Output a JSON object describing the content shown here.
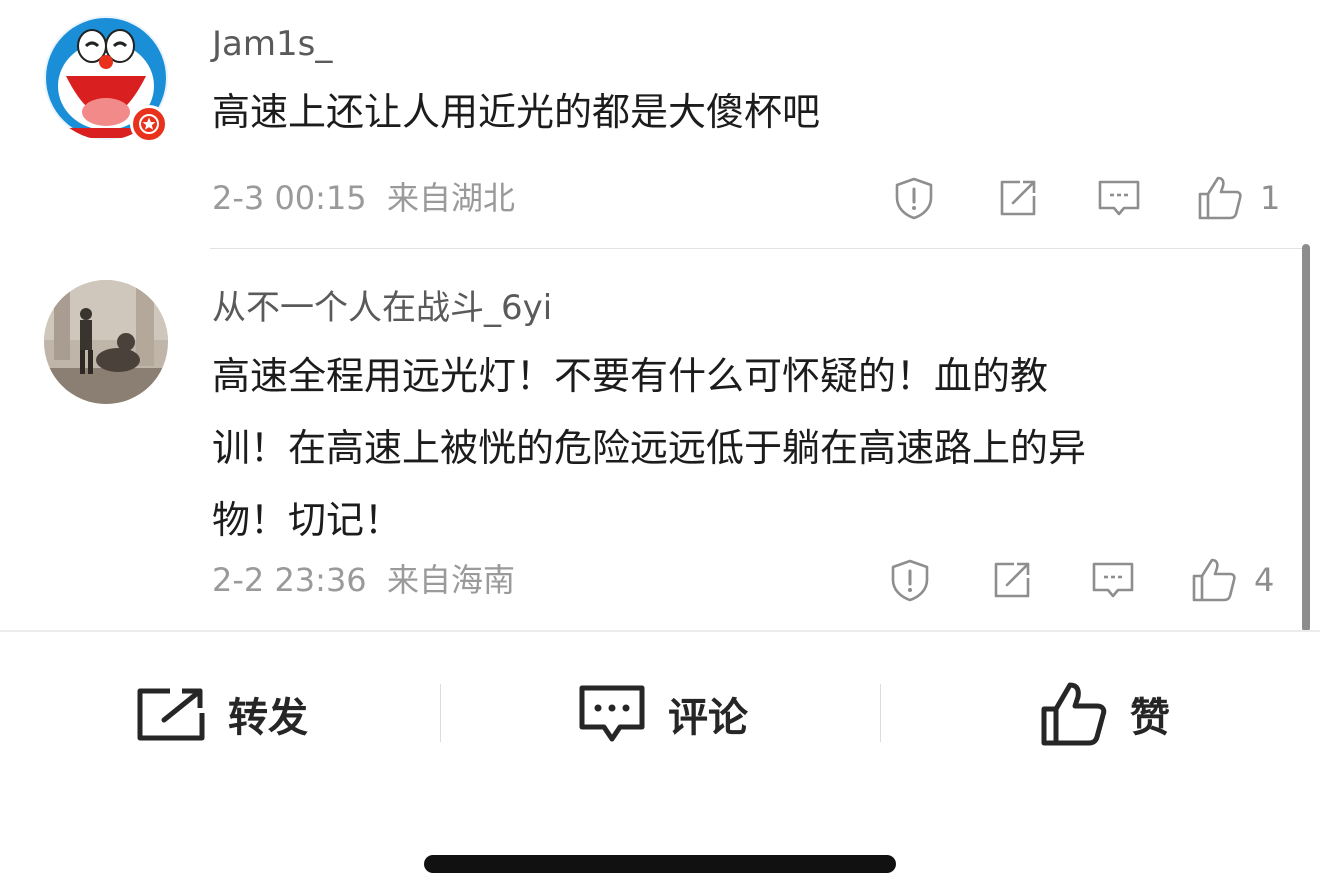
{
  "comments": [
    {
      "username": "Jam1s_",
      "text": "高速上还让人用近光的都是大傻杯吧",
      "time": "2-3 00:15",
      "location": "来自湖北",
      "likes": "1",
      "avatar_icon": "doraemon-avatar",
      "badge_icon": "star-badge-icon"
    },
    {
      "username": "从不一个人在战斗_6yi",
      "text_lines": [
        "高速全程用远光灯！不要有什么可怀疑的！血的教",
        "训！在高速上被恍的危险远远低于躺在高速路上的异",
        "物！切记！"
      ],
      "time": "2-2 23:36",
      "location": "来自海南",
      "likes": "4",
      "avatar_icon": "photo-avatar"
    }
  ],
  "bottom_bar": {
    "repost_label": "转发",
    "comment_label": "评论",
    "like_label": "赞"
  },
  "colors": {
    "badge_red": "#e8321c",
    "text": "#1c1c1c",
    "meta": "#9a9a9a"
  }
}
